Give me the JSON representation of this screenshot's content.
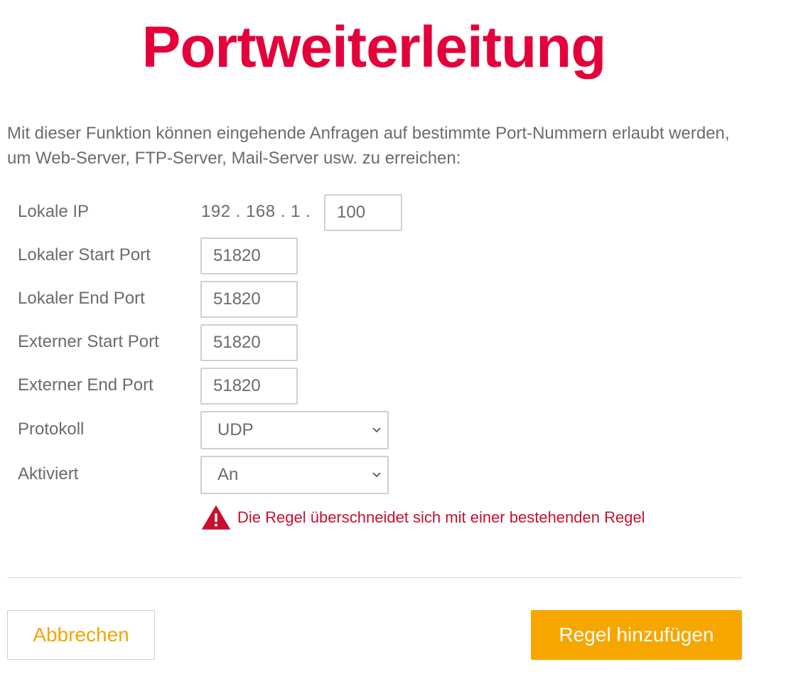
{
  "title": "Portweiterleitung",
  "intro": "Mit dieser Funktion können eingehende Anfragen auf bestimmte Port-Nummern erlaubt werden, um Web-Server, FTP-Server, Mail-Server usw. zu erreichen:",
  "form": {
    "local_ip": {
      "label": "Lokale IP",
      "prefix": "192 . 168 . 1 .",
      "value": "100"
    },
    "local_start_port": {
      "label": "Lokaler Start Port",
      "value": "51820"
    },
    "local_end_port": {
      "label": "Lokaler End Port",
      "value": "51820"
    },
    "external_start_port": {
      "label": "Externer Start Port",
      "value": "51820"
    },
    "external_end_port": {
      "label": "Externer End Port",
      "value": "51820"
    },
    "protocol": {
      "label": "Protokoll",
      "selected": "UDP"
    },
    "enabled": {
      "label": "Aktiviert",
      "selected": "An"
    }
  },
  "warning": {
    "icon": "warning-triangle-icon",
    "text": "Die Regel überschneidet sich mit einer bestehenden Regel",
    "color": "#c8102e"
  },
  "buttons": {
    "cancel": "Abbrechen",
    "add": "Regel hinzufügen"
  },
  "colors": {
    "title": "#e4003a",
    "accent": "#f7a600"
  }
}
